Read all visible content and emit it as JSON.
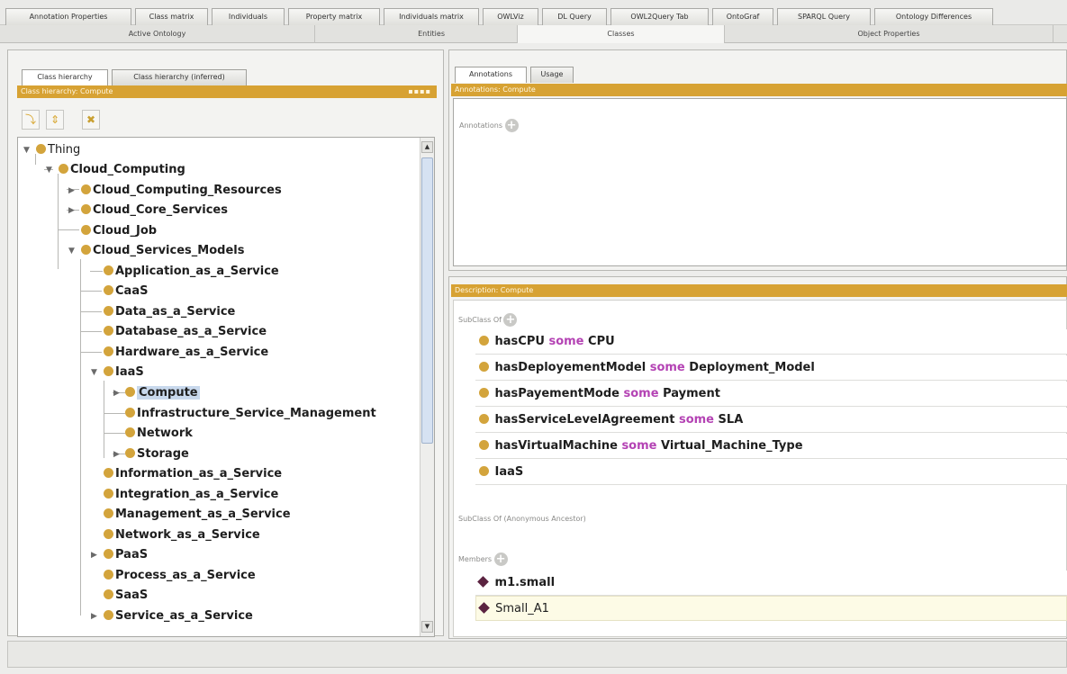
{
  "top_tabs": [
    "Annotation Properties",
    "Class matrix",
    "Individuals",
    "Property matrix",
    "Individuals matrix",
    "OWLViz",
    "DL Query",
    "OWL2Query Tab",
    "OntoGraf",
    "SPARQL Query",
    "Ontology Differences"
  ],
  "mid_tabs": [
    "Active Ontology",
    "Entities",
    "Classes",
    "Object Properties"
  ],
  "left": {
    "tabs": [
      "Class hierarchy",
      "Class hierarchy (inferred)"
    ],
    "bar_title": "Class hierarchy: Compute",
    "tree": [
      "Thing",
      "Cloud_Computing",
      "Cloud_Computing_Resources",
      "Cloud_Core_Services",
      "Cloud_Job",
      "Cloud_Services_Models",
      "Application_as_a_Service",
      "CaaS",
      "Data_as_a_Service",
      "Database_as_a_Service",
      "Hardware_as_a_Service",
      "IaaS",
      "Compute",
      "Infrastructure_Service_Management",
      "Network",
      "Storage",
      "Information_as_a_Service",
      "Integration_as_a_Service",
      "Management_as_a_Service",
      "Network_as_a_Service",
      "PaaS",
      "Process_as_a_Service",
      "SaaS",
      "Service_as_a_Service"
    ],
    "selected": "Compute"
  },
  "annotations": {
    "tabs": [
      "Annotations",
      "Usage"
    ],
    "bar_title": "Annotations: Compute",
    "label": "Annotations"
  },
  "description": {
    "bar_title": "Description: Compute",
    "subclass_label": "SubClass Of",
    "axioms": [
      {
        "prop": "hasCPU",
        "kw": "some",
        "target": "CPU"
      },
      {
        "prop": "hasDeployementModel",
        "kw": "some",
        "target": "Deployment_Model"
      },
      {
        "prop": "hasPayementMode",
        "kw": "some",
        "target": "Payment"
      },
      {
        "prop": "hasServiceLevelAgreement",
        "kw": "some",
        "target": "SLA"
      },
      {
        "prop": "hasVirtualMachine",
        "kw": "some",
        "target": "Virtual_Machine_Type"
      },
      {
        "prop": "IaaS",
        "kw": "",
        "target": ""
      }
    ],
    "anon_label": "SubClass Of (Anonymous Ancestor)",
    "members_label": "Members",
    "members": [
      "m1.small",
      "Small_A1"
    ]
  },
  "colors": {
    "accent_bar": "#d7a233",
    "class_dot": "#d3a43c",
    "keyword": "#b443b4",
    "individual": "#5b2340",
    "selected_row": "#c8d8ec"
  }
}
